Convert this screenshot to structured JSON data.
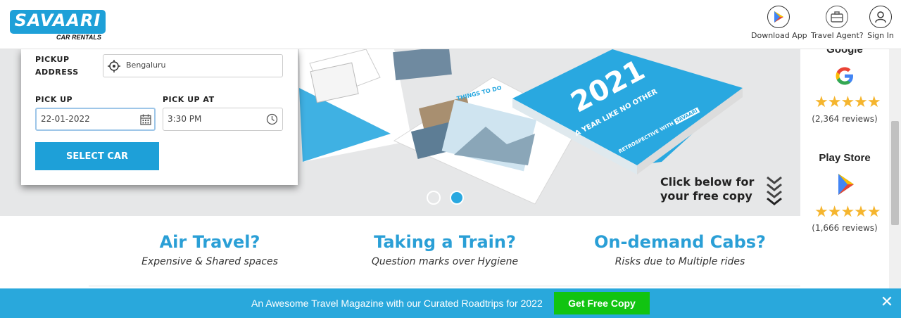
{
  "header": {
    "logo_text": "SAVAARI",
    "logo_sub": "CAR RENTALS",
    "download_app": "Download App",
    "travel_agent": "Travel Agent?",
    "sign_in": "Sign In"
  },
  "booking": {
    "pickup_address_label_1": "PICKUP",
    "pickup_address_label_2": "ADDRESS",
    "pickup_address_value": "Bengaluru",
    "pickup_label": "PICK UP",
    "pickup_date": "22-01-2022",
    "pickup_at_label": "PICK UP AT",
    "pickup_time": "3:30 PM",
    "select_car": "SELECT CAR"
  },
  "hero": {
    "cover_year": "2021",
    "cover_tagline": "A YEAR LIKE NO OTHER",
    "cover_retro": "RETROSPECTIVE WITH",
    "cover_brand": "SAVAARI",
    "spread_heading": "THINGS TO DO",
    "cta_line1": "Click below for",
    "cta_line2": "your free copy"
  },
  "ratings": {
    "google_title": "Google",
    "google_reviews": "(2,364 reviews)",
    "play_title": "Play Store",
    "play_reviews": "(1,666 reviews)",
    "stars_glyphs": "★★★★★"
  },
  "features": [
    {
      "title": "Air Travel?",
      "subtitle": "Expensive & Shared spaces"
    },
    {
      "title": "Taking a Train?",
      "subtitle": "Question marks over Hygiene"
    },
    {
      "title": "On-demand Cabs?",
      "subtitle": "Risks due to Multiple rides"
    }
  ],
  "banner": {
    "text": "An Awesome Travel Magazine with our Curated Roadtrips for 2022",
    "button": "Get Free Copy",
    "close": "✕"
  },
  "colors": {
    "brand_blue": "#1ea0d8",
    "cta_green": "#11c411",
    "star_gold": "#f5b52e"
  }
}
